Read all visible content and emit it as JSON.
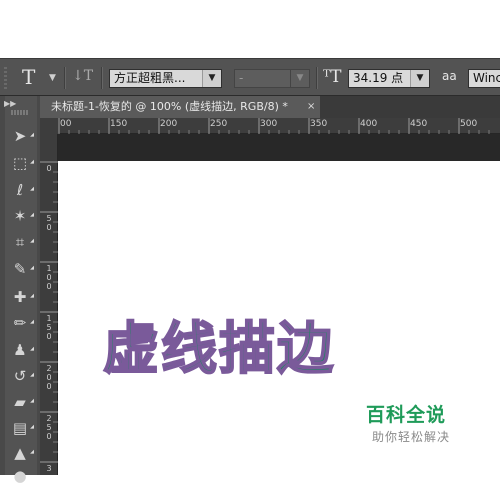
{
  "options_bar": {
    "tool_icon": "T",
    "orientation_icon": "text-orientation-icon",
    "font_family": "方正超粗黑...",
    "font_style": "-",
    "size_icon": "font-size-icon",
    "font_size": "34.19 点",
    "anti_alias_icon": "aa",
    "anti_alias_value": "Winc"
  },
  "document_tab": {
    "title": "未标题-1-恢复的 @ 100% (虚线描边, RGB/8) *",
    "close": "×"
  },
  "ruler": {
    "h_labels": [
      "00",
      "150",
      "200",
      "250",
      "300",
      "350",
      "400",
      "450",
      "500"
    ],
    "v_labels": [
      "0",
      "5\n0",
      "1\n0\n0",
      "1\n5\n0",
      "2\n0\n0",
      "2\n5\n0",
      "3"
    ]
  },
  "tools": [
    "move-icon",
    "marquee-icon",
    "lasso-icon",
    "magic-wand-icon",
    "crop-icon",
    "eyedropper-icon",
    "healing-brush-icon",
    "brush-icon",
    "stamp-icon",
    "history-brush-icon",
    "eraser-icon",
    "gradient-icon",
    "blur-icon",
    "dodge-icon"
  ],
  "canvas": {
    "artwork_text": "虚线描边",
    "text_color": "#1a8a5d",
    "stroke_color": "#7a5a9a"
  },
  "watermark": {
    "title": "百科全说",
    "subtitle": "助你轻松解决"
  }
}
